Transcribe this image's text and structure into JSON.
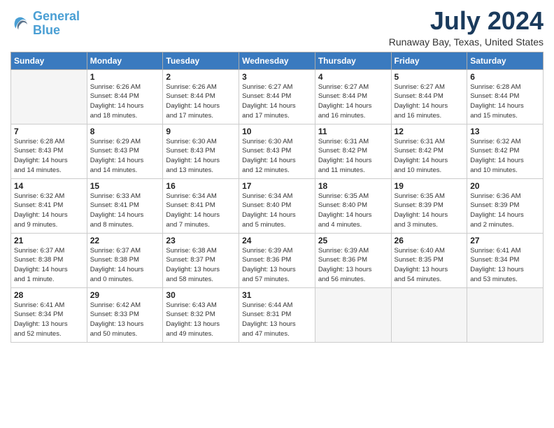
{
  "header": {
    "logo_general": "General",
    "logo_blue": "Blue",
    "title": "July 2024",
    "subtitle": "Runaway Bay, Texas, United States"
  },
  "weekdays": [
    "Sunday",
    "Monday",
    "Tuesday",
    "Wednesday",
    "Thursday",
    "Friday",
    "Saturday"
  ],
  "weeks": [
    [
      {
        "day": "",
        "info": ""
      },
      {
        "day": "1",
        "info": "Sunrise: 6:26 AM\nSunset: 8:44 PM\nDaylight: 14 hours\nand 18 minutes."
      },
      {
        "day": "2",
        "info": "Sunrise: 6:26 AM\nSunset: 8:44 PM\nDaylight: 14 hours\nand 17 minutes."
      },
      {
        "day": "3",
        "info": "Sunrise: 6:27 AM\nSunset: 8:44 PM\nDaylight: 14 hours\nand 17 minutes."
      },
      {
        "day": "4",
        "info": "Sunrise: 6:27 AM\nSunset: 8:44 PM\nDaylight: 14 hours\nand 16 minutes."
      },
      {
        "day": "5",
        "info": "Sunrise: 6:27 AM\nSunset: 8:44 PM\nDaylight: 14 hours\nand 16 minutes."
      },
      {
        "day": "6",
        "info": "Sunrise: 6:28 AM\nSunset: 8:44 PM\nDaylight: 14 hours\nand 15 minutes."
      }
    ],
    [
      {
        "day": "7",
        "info": "Sunrise: 6:28 AM\nSunset: 8:43 PM\nDaylight: 14 hours\nand 14 minutes."
      },
      {
        "day": "8",
        "info": "Sunrise: 6:29 AM\nSunset: 8:43 PM\nDaylight: 14 hours\nand 14 minutes."
      },
      {
        "day": "9",
        "info": "Sunrise: 6:30 AM\nSunset: 8:43 PM\nDaylight: 14 hours\nand 13 minutes."
      },
      {
        "day": "10",
        "info": "Sunrise: 6:30 AM\nSunset: 8:43 PM\nDaylight: 14 hours\nand 12 minutes."
      },
      {
        "day": "11",
        "info": "Sunrise: 6:31 AM\nSunset: 8:42 PM\nDaylight: 14 hours\nand 11 minutes."
      },
      {
        "day": "12",
        "info": "Sunrise: 6:31 AM\nSunset: 8:42 PM\nDaylight: 14 hours\nand 10 minutes."
      },
      {
        "day": "13",
        "info": "Sunrise: 6:32 AM\nSunset: 8:42 PM\nDaylight: 14 hours\nand 10 minutes."
      }
    ],
    [
      {
        "day": "14",
        "info": "Sunrise: 6:32 AM\nSunset: 8:41 PM\nDaylight: 14 hours\nand 9 minutes."
      },
      {
        "day": "15",
        "info": "Sunrise: 6:33 AM\nSunset: 8:41 PM\nDaylight: 14 hours\nand 8 minutes."
      },
      {
        "day": "16",
        "info": "Sunrise: 6:34 AM\nSunset: 8:41 PM\nDaylight: 14 hours\nand 7 minutes."
      },
      {
        "day": "17",
        "info": "Sunrise: 6:34 AM\nSunset: 8:40 PM\nDaylight: 14 hours\nand 5 minutes."
      },
      {
        "day": "18",
        "info": "Sunrise: 6:35 AM\nSunset: 8:40 PM\nDaylight: 14 hours\nand 4 minutes."
      },
      {
        "day": "19",
        "info": "Sunrise: 6:35 AM\nSunset: 8:39 PM\nDaylight: 14 hours\nand 3 minutes."
      },
      {
        "day": "20",
        "info": "Sunrise: 6:36 AM\nSunset: 8:39 PM\nDaylight: 14 hours\nand 2 minutes."
      }
    ],
    [
      {
        "day": "21",
        "info": "Sunrise: 6:37 AM\nSunset: 8:38 PM\nDaylight: 14 hours\nand 1 minute."
      },
      {
        "day": "22",
        "info": "Sunrise: 6:37 AM\nSunset: 8:38 PM\nDaylight: 14 hours\nand 0 minutes."
      },
      {
        "day": "23",
        "info": "Sunrise: 6:38 AM\nSunset: 8:37 PM\nDaylight: 13 hours\nand 58 minutes."
      },
      {
        "day": "24",
        "info": "Sunrise: 6:39 AM\nSunset: 8:36 PM\nDaylight: 13 hours\nand 57 minutes."
      },
      {
        "day": "25",
        "info": "Sunrise: 6:39 AM\nSunset: 8:36 PM\nDaylight: 13 hours\nand 56 minutes."
      },
      {
        "day": "26",
        "info": "Sunrise: 6:40 AM\nSunset: 8:35 PM\nDaylight: 13 hours\nand 54 minutes."
      },
      {
        "day": "27",
        "info": "Sunrise: 6:41 AM\nSunset: 8:34 PM\nDaylight: 13 hours\nand 53 minutes."
      }
    ],
    [
      {
        "day": "28",
        "info": "Sunrise: 6:41 AM\nSunset: 8:34 PM\nDaylight: 13 hours\nand 52 minutes."
      },
      {
        "day": "29",
        "info": "Sunrise: 6:42 AM\nSunset: 8:33 PM\nDaylight: 13 hours\nand 50 minutes."
      },
      {
        "day": "30",
        "info": "Sunrise: 6:43 AM\nSunset: 8:32 PM\nDaylight: 13 hours\nand 49 minutes."
      },
      {
        "day": "31",
        "info": "Sunrise: 6:44 AM\nSunset: 8:31 PM\nDaylight: 13 hours\nand 47 minutes."
      },
      {
        "day": "",
        "info": ""
      },
      {
        "day": "",
        "info": ""
      },
      {
        "day": "",
        "info": ""
      }
    ]
  ]
}
